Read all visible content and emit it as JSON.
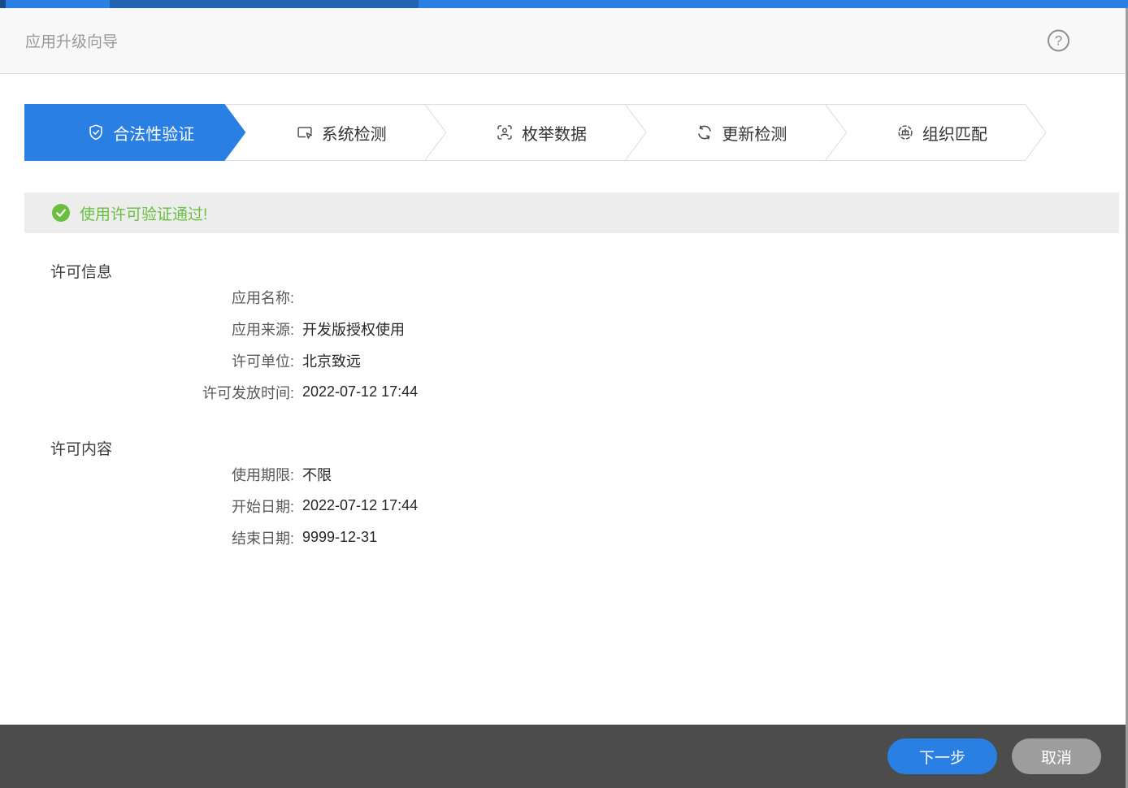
{
  "window": {
    "title": "应用升级向导",
    "help_icon": "help-circle-icon"
  },
  "topbar": {
    "color": "#2a7fe2",
    "dark_segment_color": "#2264b0"
  },
  "stepper": {
    "active_index": 0,
    "active_color": "#2a7fe2",
    "steps": [
      {
        "label": "合法性验证",
        "icon": "shield-check-icon"
      },
      {
        "label": "系统检测",
        "icon": "monitor-click-icon"
      },
      {
        "label": "枚举数据",
        "icon": "person-scan-icon"
      },
      {
        "label": "更新检测",
        "icon": "refresh-icon"
      },
      {
        "label": "组织匹配",
        "icon": "org-match-icon"
      }
    ]
  },
  "status": {
    "message": "使用许可验证通过!",
    "icon": "check-circle-icon",
    "color": "#6abf40"
  },
  "license_info": {
    "heading": "许可信息",
    "rows": [
      {
        "label": "应用名称:",
        "value": ""
      },
      {
        "label": "应用来源:",
        "value": "开发版授权使用"
      },
      {
        "label": "许可单位:",
        "value": "北京致远"
      },
      {
        "label": "许可发放时间:",
        "value": "2022-07-12 17:44"
      }
    ]
  },
  "license_content": {
    "heading": "许可内容",
    "rows": [
      {
        "label": "使用期限:",
        "value": "不限"
      },
      {
        "label": "开始日期:",
        "value": "2022-07-12 17:44"
      },
      {
        "label": "结束日期:",
        "value": "9999-12-31"
      }
    ]
  },
  "footer": {
    "next_label": "下一步",
    "cancel_label": "取消",
    "next_color": "#2a7fe2",
    "cancel_color": "#9d9d9d"
  }
}
